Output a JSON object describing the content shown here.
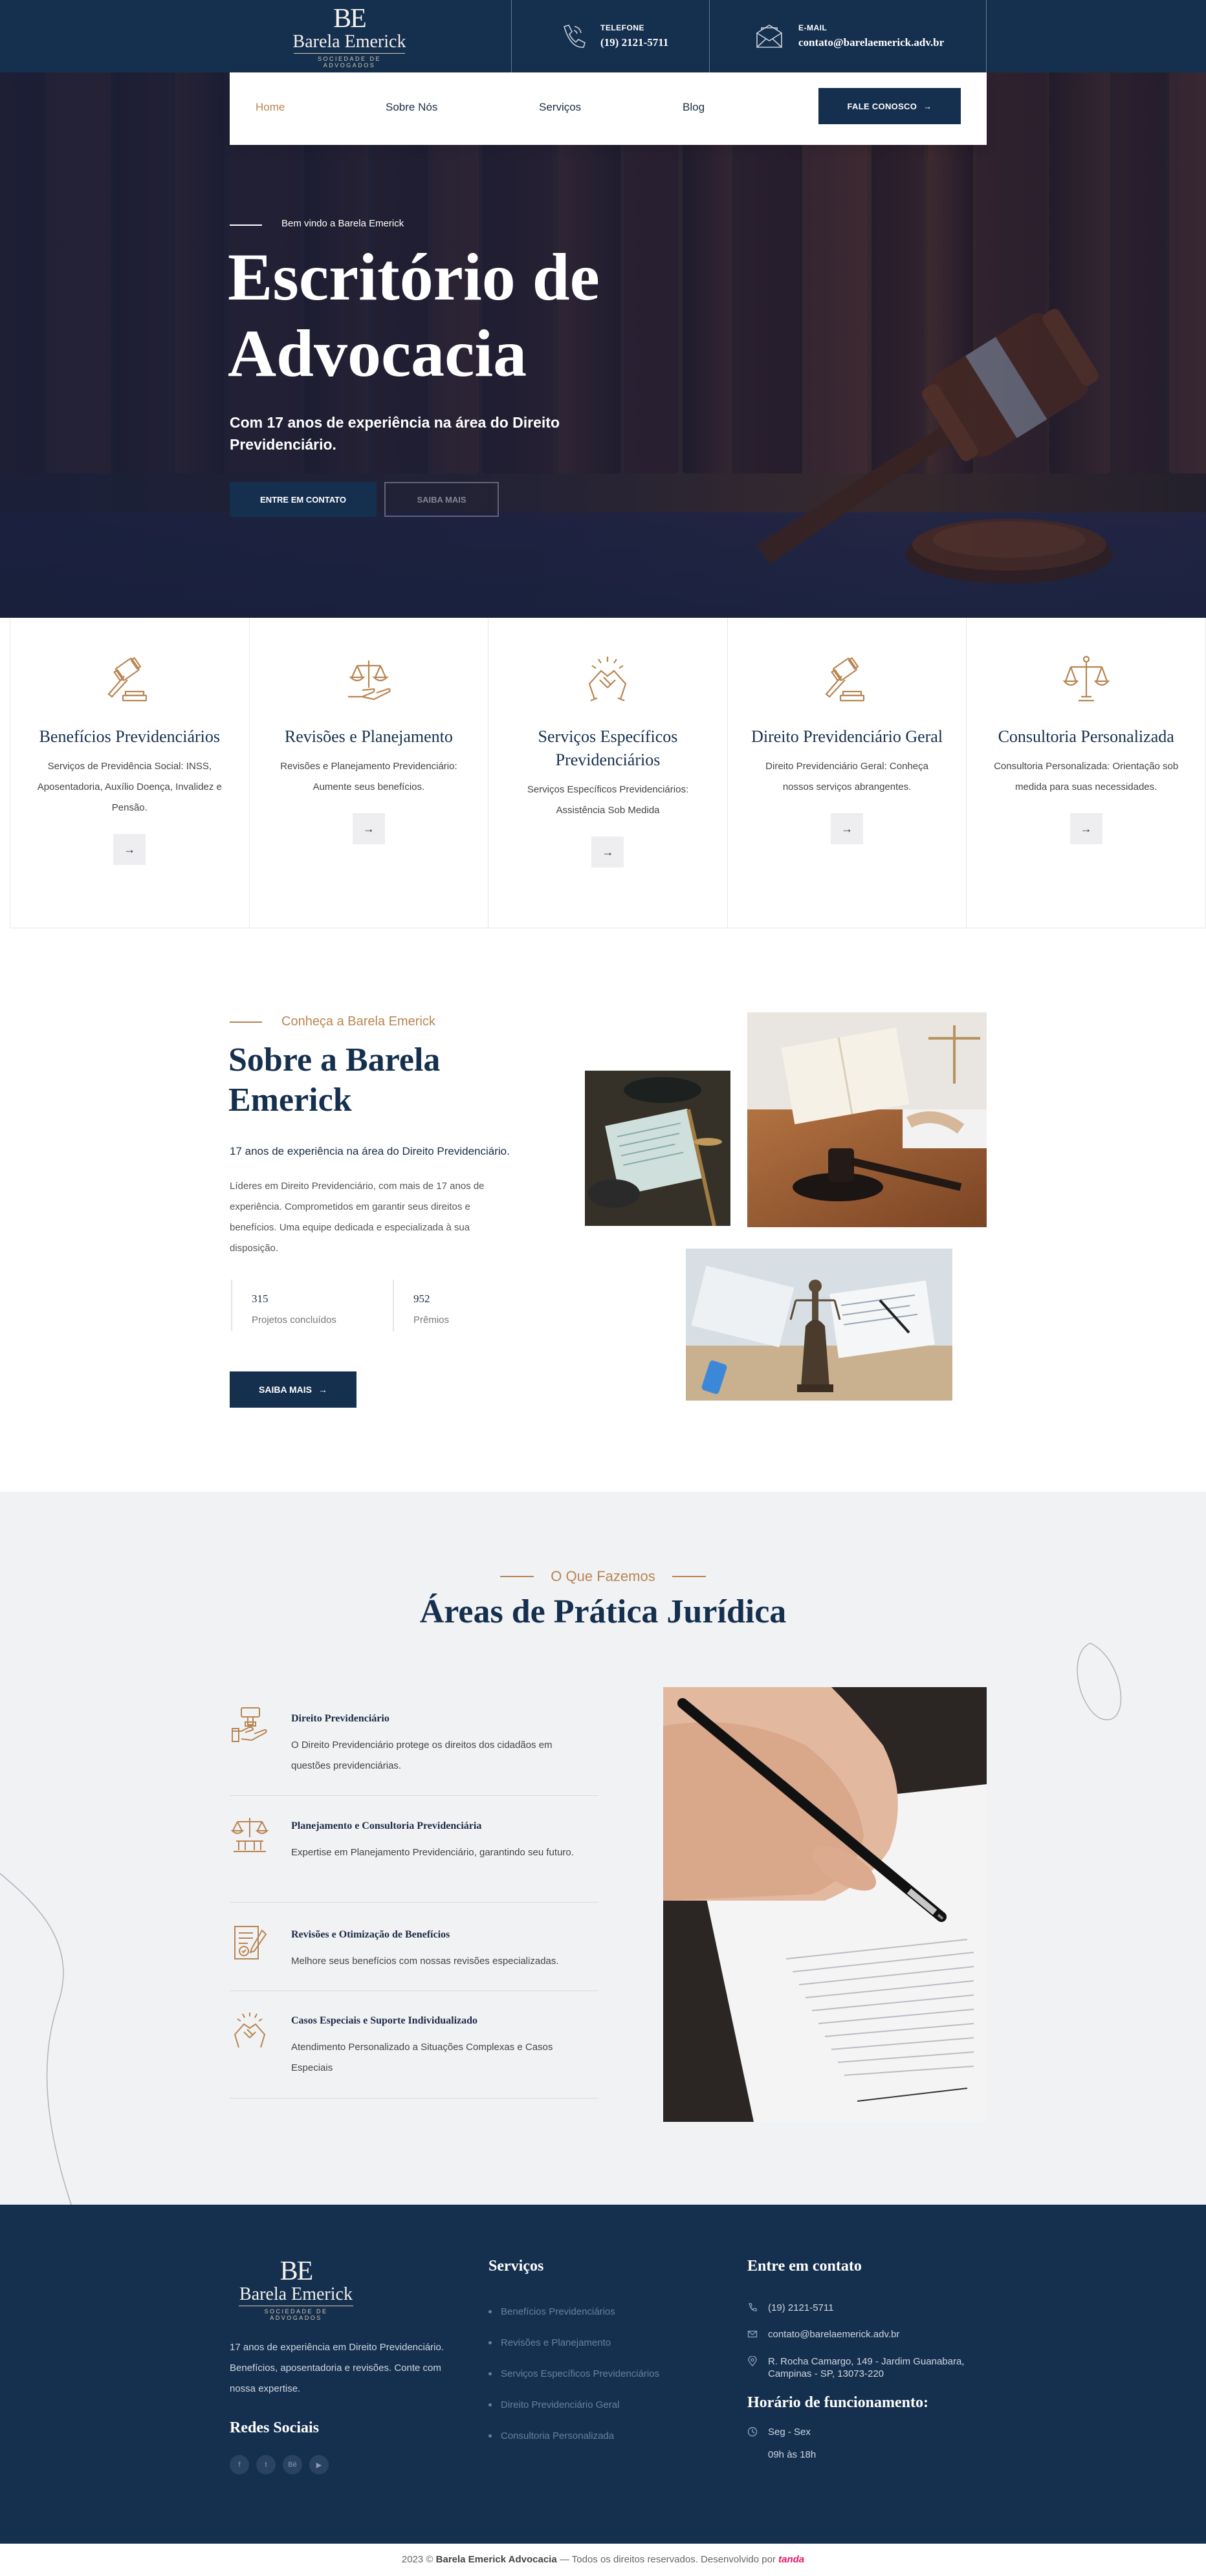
{
  "header": {
    "logo": {
      "monogram": "BE",
      "name": "Barela Emerick",
      "tagline": "SOCIEDADE DE ADVOGADOS"
    },
    "phone": {
      "label": "TELEFONE",
      "value": "(19) 2121-5711"
    },
    "email": {
      "label": "E-MAIL",
      "value": "contato@barelaemerick.adv.br"
    }
  },
  "nav": {
    "items": [
      "Home",
      "Sobre Nós",
      "Serviços",
      "Blog"
    ],
    "active": "Home",
    "cta": "FALE CONOSCO"
  },
  "hero": {
    "welcome": "Bem vindo a Barela Emerick",
    "title_line1": "Escritório de",
    "title_line2": "Advocacia",
    "subtitle": "Com 17 anos de experiência na área do Direito Previdenciário.",
    "btn_contact": "ENTRE EM CONTATO",
    "btn_more": "SAIBA MAIS"
  },
  "cards": [
    {
      "icon": "gavel-icon",
      "title": "Benefícios Previdenciários",
      "text": "Serviços de Previdência Social: INSS, Aposentadoria, Auxílio Doença, Invalidez e Pensão."
    },
    {
      "icon": "scales-hand-icon",
      "title": "Revisões e Planejamento",
      "text": "Revisões e Planejamento Previdenciário: Aumente seus benefícios."
    },
    {
      "icon": "handshake-icon",
      "title": "Serviços Específicos Previdenciários",
      "text": "Serviços Específicos Previdenciários: Assistência Sob Medida"
    },
    {
      "icon": "gavel-icon",
      "title": "Direito Previdenciário Geral",
      "text": "Direito Previdenciário Geral: Conheça nossos serviços abrangentes."
    },
    {
      "icon": "scales-icon",
      "title": "Consultoria Personalizada",
      "text": "Consultoria Personalizada: Orientação sob medida para suas necessidades."
    }
  ],
  "about": {
    "kicker": "Conheça a Barela Emerick",
    "title": "Sobre a Barela Emerick",
    "lead": "17 anos de experiência na área do Direito Previdenciário.",
    "text": "Líderes em Direito Previdenciário, com mais de 17 anos de experiência. Comprometidos em garantir seus direitos e benefícios. Uma equipe dedicada e especializada à sua disposição.",
    "stats": [
      {
        "value": "315",
        "label": "Projetos concluídos"
      },
      {
        "value": "952",
        "label": "Prêmios"
      }
    ],
    "button": "SAIBA MAIS"
  },
  "practice": {
    "kicker": "O Que Fazemos",
    "title": "Áreas de Prática Jurídica",
    "items": [
      {
        "icon": "gavel-hand-icon",
        "title": "Direito Previdenciário",
        "text": "O Direito Previdenciário protege os direitos dos cidadãos em questões previdenciárias."
      },
      {
        "icon": "scales-building-icon",
        "title": "Planejamento e Consultoria Previdenciária",
        "text": "Expertise em Planejamento Previdenciário, garantindo seu futuro."
      },
      {
        "icon": "document-check-icon",
        "title": "Revisões e Otimização de Benefícios",
        "text": "Melhore seus benefícios com nossas revisões especializadas."
      },
      {
        "icon": "handshake-icon",
        "title": "Casos Especiais e Suporte Individualizado",
        "text": "Atendimento Personalizado a Situações Complexas e Casos Especiais"
      }
    ]
  },
  "footer": {
    "about": "17 anos de experiência em Direito Previdenciário. Benefícios, aposentadoria e revisões. Conte com nossa expertise.",
    "social_title": "Redes Sociais",
    "social": [
      "f",
      "t",
      "Bē",
      "▶"
    ],
    "services_title": "Serviços",
    "services": [
      "Benefícios Previdenciários",
      "Revisões e Planejamento",
      "Serviços Específicos Previdenciários",
      "Direito Previdenciário Geral",
      "Consultoria Personalizada"
    ],
    "contact_title": "Entre em contato",
    "phone": "(19) 2121-5711",
    "email": "contato@barelaemerick.adv.br",
    "address": "R. Rocha Camargo, 149 - Jardim Guanabara, Campinas - SP, 13073-220",
    "hours_title": "Horário de funcionamento:",
    "hours_days": "Seg - Sex",
    "hours_time": "09h às 18h"
  },
  "copyright": {
    "prefix": "2023 © ",
    "company": "Barela Emerick Advocacia",
    "suffix": " — Todos os direitos reservados. Desenvolvido por ",
    "developer": "tanda"
  },
  "colors": {
    "navy": "#15304f",
    "gold": "#b98552",
    "light_bg": "#f1f2f4"
  }
}
